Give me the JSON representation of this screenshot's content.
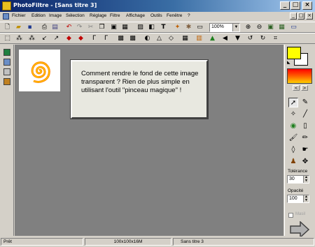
{
  "window": {
    "title": "PhotoFiltre - [Sans titre 3]",
    "buttons": [
      "_",
      "□",
      "×"
    ],
    "mdi_buttons": [
      "_",
      "□",
      "×"
    ]
  },
  "menu": {
    "items": [
      "Fichier",
      "Edition",
      "Image",
      "Sélection",
      "Réglage",
      "Filtre",
      "Affichage",
      "Outils",
      "Fenêtre",
      "?"
    ]
  },
  "toolbar": {
    "zoom_value": "100%"
  },
  "tooltip": {
    "text": "Comment rendre le fond de cette image transparent ? Rien de plus simple en utilisant l'outil \"pinceau magique\" !"
  },
  "right_panel": {
    "foreground_color": "#ffff00",
    "background_color": "#ffffff",
    "tolerance_label": "Tolérance",
    "tolerance_value": "30",
    "opacity_label": "Opacité",
    "opacity_value": "100",
    "mask_label": "Masil",
    "grad_prev": "<",
    "grad_next": ">"
  },
  "status": {
    "state": "Prêt",
    "dimensions": "100x100x16M",
    "doc_name": "Sans titre 3"
  },
  "icons": {
    "tools": [
      "selection-arrow-icon",
      "eyedropper-icon",
      "magic-wand-icon",
      "line-icon",
      "fill-bucket-icon",
      "spray-icon",
      "brush-icon",
      "pencil-icon",
      "blur-drop-icon",
      "smudge-icon",
      "stamp-icon",
      "clone-icon"
    ]
  }
}
